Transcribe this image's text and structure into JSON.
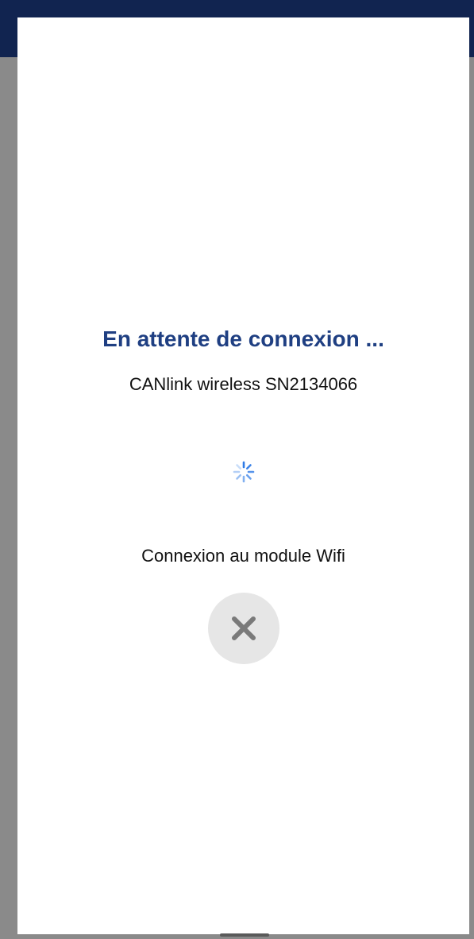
{
  "header": {
    "background_color": "#112450"
  },
  "dialog": {
    "title": "En attente de connexion ...",
    "device_name": "CANlink wireless SN2134066",
    "status_text": "Connexion au module Wifi",
    "spinner_icon": "loading-spinner-icon",
    "close_icon": "close-icon",
    "accent_color": "#1f3f82"
  }
}
